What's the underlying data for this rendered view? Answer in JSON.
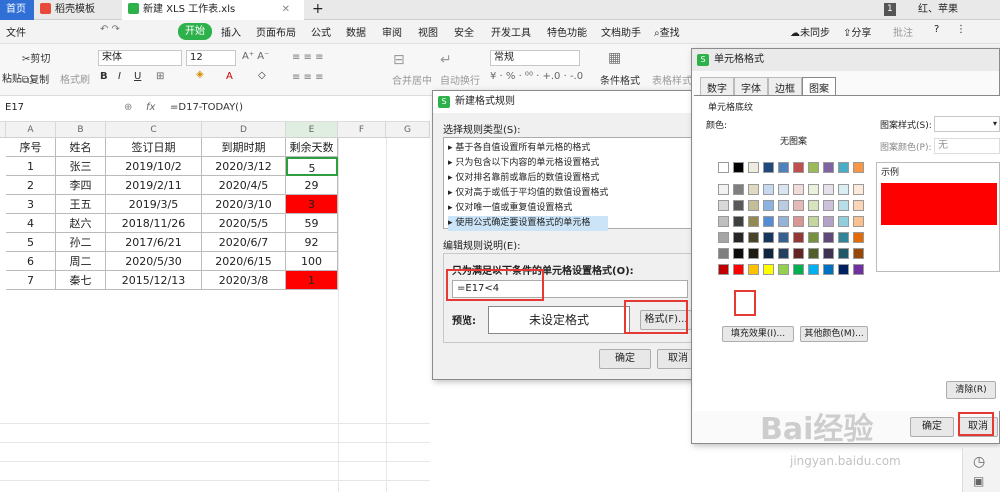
{
  "tabs": [
    {
      "label": "首页"
    },
    {
      "label": "稻壳模板"
    },
    {
      "label": "新建 XLS 工作表.xls"
    }
  ],
  "titlebar": {
    "badge": "1",
    "user": "红、苹果"
  },
  "menu": {
    "file": "文件",
    "start": "开始",
    "items": [
      "插入",
      "页面布局",
      "公式",
      "数据",
      "审阅",
      "视图",
      "安全",
      "开发工具",
      "特色功能",
      "文档助手"
    ],
    "search": "查找",
    "sync": "未同步",
    "share": "分享",
    "annotate": "批注"
  },
  "ribbon": {
    "cut": "剪切",
    "copy": "复制",
    "paste": "粘贴",
    "format_painter": "格式刷",
    "font": "宋体",
    "size": "12",
    "merge": "合并居中",
    "wrap": "自动换行",
    "numfmt": "常规",
    "cond_fmt": "条件格式",
    "table_style": "表格样式"
  },
  "formula": {
    "cell_ref": "E17",
    "fx": "fx",
    "formula": "=D17-TODAY()"
  },
  "columns": [
    "A",
    "B",
    "C",
    "D",
    "E",
    "F",
    "G"
  ],
  "headers": [
    "序号",
    "姓名",
    "签订日期",
    "到期时期",
    "剩余天数"
  ],
  "rows": [
    [
      "1",
      "张三",
      "2019/10/2",
      "2020/3/12",
      "5"
    ],
    [
      "2",
      "李四",
      "2019/2/11",
      "2020/4/5",
      "29"
    ],
    [
      "3",
      "王五",
      "2019/3/5",
      "2020/3/10",
      "3"
    ],
    [
      "4",
      "赵六",
      "2018/11/26",
      "2020/5/5",
      "59"
    ],
    [
      "5",
      "孙二",
      "2017/6/21",
      "2020/6/7",
      "92"
    ],
    [
      "6",
      "周二",
      "2020/5/30",
      "2020/6/15",
      "100"
    ],
    [
      "7",
      "秦七",
      "2015/12/13",
      "2020/3/8",
      "1"
    ]
  ],
  "highlight_color": "#ff0000",
  "rule_dialog": {
    "title": "新建格式规则",
    "select_type": "选择规则类型(S):",
    "types": [
      "基于各自值设置所有单元格的格式",
      "只为包含以下内容的单元格设置格式",
      "仅对排名靠前或靠后的数值设置格式",
      "仅对高于或低于平均值的数值设置格式",
      "仅对唯一值或重复值设置格式",
      "使用公式确定要设置格式的单元格"
    ],
    "edit_desc": "编辑规则说明(E):",
    "formula_label": "只为满足以下条件的单元格设置格式(O):",
    "formula_value": "=E17<4",
    "preview_label": "预览:",
    "preview_text": "未设定格式",
    "format_btn": "格式(F)...",
    "ok": "确定",
    "cancel": "取消"
  },
  "cell_dialog": {
    "title": "单元格格式",
    "tabs": [
      "数字",
      "字体",
      "边框",
      "图案"
    ],
    "shading": "单元格底纹",
    "color_label": "颜色:",
    "no_color": "无图案",
    "pattern_style": "图案样式(S):",
    "pattern_color": "图案颜色(P):",
    "pattern_color_value": "无",
    "sample": "示例",
    "fill_effects": "填充效果(I)...",
    "more_colors": "其他颜色(M)...",
    "clear": "清除(R)",
    "ok": "确定",
    "cancel": "取消",
    "sample_color": "#ff0000"
  },
  "watermark": {
    "text": "Bai经验",
    "url": "jingyan.baidu.com"
  }
}
